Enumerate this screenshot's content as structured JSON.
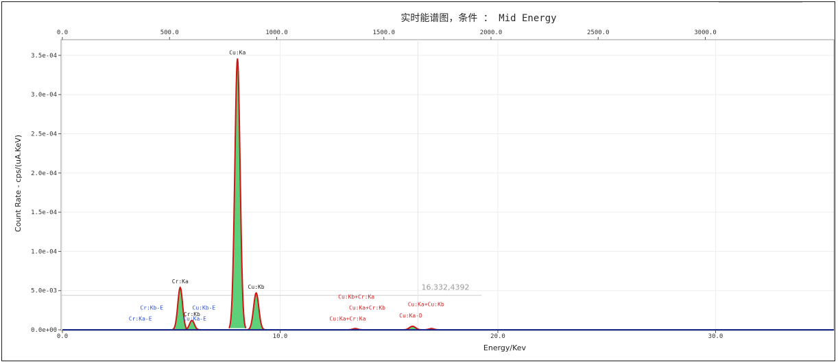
{
  "chart_data": {
    "type": "area",
    "title": "实时能谱图，条件  ： Mid Energy",
    "xlabel": "Energy/Kev",
    "ylabel": "Count Rate - cps/(uA.KeV)",
    "xlim": [
      0,
      35
    ],
    "ylim": [
      0,
      0.00037
    ],
    "x_ticks": [
      0,
      10,
      20,
      30
    ],
    "x_tick_labels": [
      "0.0",
      "10.0",
      "20.0",
      "30.0"
    ],
    "top_x_ticks": [
      0,
      500,
      1000,
      1500,
      2000,
      2500,
      3000
    ],
    "top_x_tick_labels": [
      "0.0",
      "500.0",
      "1000.0",
      "1500.0",
      "2000.0",
      "2500.0",
      "3000.0"
    ],
    "top_xlim": [
      0,
      3600
    ],
    "y_ticks": [
      0,
      5e-05,
      0.0001,
      0.00015,
      0.0002,
      0.00025,
      0.0003,
      0.00035
    ],
    "y_tick_labels": [
      "0.0e+00",
      "5.0e-03",
      "1.0e-04",
      "1.5e-04",
      "2.0e-04",
      "2.5e-04",
      "3.0e-04",
      "3.5e-04"
    ],
    "peaks": [
      {
        "energy": 5.41,
        "height": 5.4e-05,
        "width": 0.11,
        "label": "Cr:Ka"
      },
      {
        "energy": 5.95,
        "height": 1.2e-05,
        "width": 0.11,
        "label": "Cr:Kb"
      },
      {
        "energy": 8.04,
        "height": 0.000346,
        "width": 0.12,
        "label": "Cu:Ka"
      },
      {
        "energy": 8.9,
        "height": 4.7e-05,
        "width": 0.12,
        "label": "Cu:Kb"
      },
      {
        "energy": 13.45,
        "height": 1.5e-06,
        "width": 0.12,
        "label": ""
      },
      {
        "energy": 16.08,
        "height": 4.5e-06,
        "width": 0.14,
        "label": ""
      },
      {
        "energy": 16.95,
        "height": 1.5e-06,
        "width": 0.12,
        "label": ""
      }
    ],
    "escape_labels": [
      {
        "text": "Cr:Kb-E",
        "energy": 4.1,
        "level": 2.57e-05
      },
      {
        "text": "Cr:Ka-E",
        "energy": 3.58,
        "level": 1.17e-05
      },
      {
        "text": "Cu:Kb-E",
        "energy": 6.5,
        "level": 2.57e-05
      },
      {
        "text": "Cu:Ka-E",
        "energy": 6.08,
        "level": 1.17e-05
      }
    ],
    "sum_labels": [
      {
        "text": "Cu:Kb+Cr:Ka",
        "energy": 13.5,
        "level": 3.95e-05
      },
      {
        "text": "Cu:Ka+Cr:Kb",
        "energy": 14.0,
        "level": 2.57e-05
      },
      {
        "text": "Cu:Ka+Cr:Ka",
        "energy": 13.1,
        "level": 1.17e-05
      },
      {
        "text": "Cu:Ka+Cu:Kb",
        "energy": 16.7,
        "level": 3e-05
      },
      {
        "text": "Cu:Ka-D",
        "energy": 16.0,
        "level": 1.55e-05
      }
    ],
    "cursor": {
      "energy": 16.33,
      "value": 4.4e-05,
      "text": "16.332,4392"
    },
    "colors": {
      "fill": "#5fd07a",
      "outline": "#d11414",
      "baseline": "#1d2a8c",
      "grid": "#eeeeee"
    }
  }
}
